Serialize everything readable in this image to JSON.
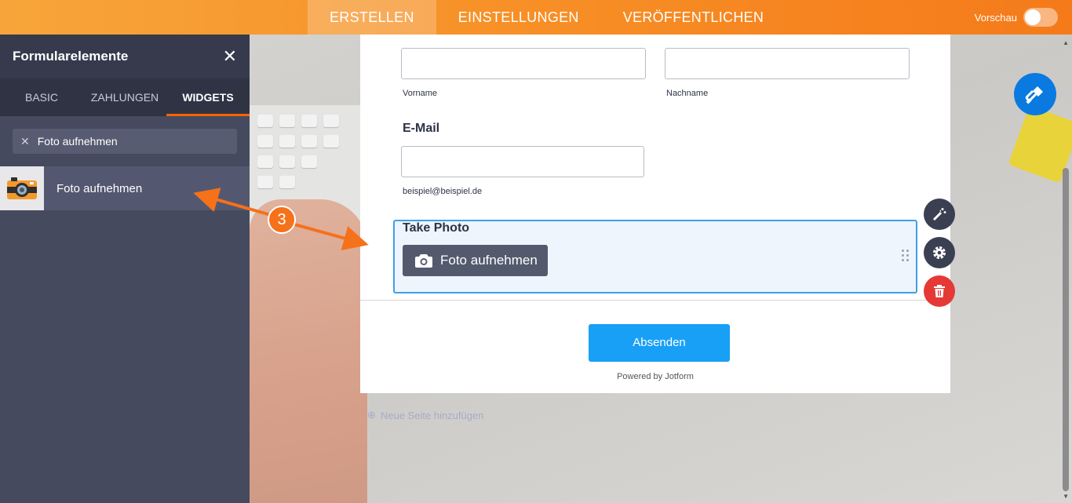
{
  "topbar": {
    "tabs": [
      {
        "label": "ERSTELLEN",
        "active": true
      },
      {
        "label": "EINSTELLUNGEN",
        "active": false
      },
      {
        "label": "VERÖFFENTLICHEN",
        "active": false
      }
    ],
    "preview_label": "Vorschau",
    "preview_on": false
  },
  "sidebar": {
    "title": "Formularelemente",
    "tabs": [
      {
        "label": "BASIC",
        "active": false
      },
      {
        "label": "ZAHLUNGEN",
        "active": false
      },
      {
        "label": "WIDGETS",
        "active": true
      }
    ],
    "search_value": "Foto aufnehmen",
    "results": [
      {
        "label": "Foto aufnehmen",
        "icon": "camera-icon"
      }
    ]
  },
  "form": {
    "first_name_sublabel": "Vorname",
    "last_name_sublabel": "Nachname",
    "email_label": "E-Mail",
    "email_sublabel": "beispiel@beispiel.de",
    "take_photo_label": "Take Photo",
    "take_photo_button": "Foto aufnehmen",
    "submit_label": "Absenden",
    "powered_by": "Powered by Jotform"
  },
  "add_page_label": "Neue Seite hinzufügen",
  "annotation": {
    "step": "3"
  },
  "colors": {
    "accent": "#f78f26",
    "submit": "#18a0f6",
    "selected_border": "#3fa0e8",
    "delete": "#e53935"
  }
}
